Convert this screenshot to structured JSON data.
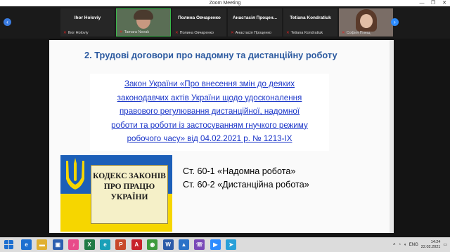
{
  "window": {
    "title": "Zoom Meeting",
    "controls": [
      "—",
      "❐",
      "✕"
    ]
  },
  "gallery": {
    "participants": [
      {
        "name": "Ihor Holoviy",
        "label": "Ihor Holoviy",
        "video": false
      },
      {
        "name": "",
        "label": "Tamara Novak",
        "video": true
      },
      {
        "name": "Полина Овчаренко",
        "label": "Полина Овчаренко",
        "video": false
      },
      {
        "name": "Анастасія Процен...",
        "label": "Анастасія Проценко",
        "video": false
      },
      {
        "name": "Tetiana Kondratiuk",
        "label": "Tetiana Kondratiuk",
        "video": false
      },
      {
        "name": "",
        "label": "София Плещ",
        "video": true
      }
    ]
  },
  "slide": {
    "heading": "2. Трудові договори про надомну та дистанційну роботу",
    "law_lines": [
      "Закон України «Про внесення змін до деяких",
      "законодавчих актів України щодо удосконалення",
      "правового регулювання дистанційної, надомної",
      "роботи та роботи із застосуванням гнучкого режиму",
      "робочого часу» від 04.02.2021 р. № 1213-IX"
    ],
    "code_title_lines": [
      "КОДЕКС ЗАКОНІВ",
      "ПРО ПРАЦЮ",
      "УКРАЇНИ"
    ],
    "articles": [
      "Ст. 60-1 «Надомна робота»",
      "Ст. 60-2 «Дистанційна робота»"
    ]
  },
  "taskbar": {
    "apps": [
      {
        "icon": "edge-legacy-icon",
        "glyph": "e",
        "color": "#1e6fd0"
      },
      {
        "icon": "file-explorer-icon",
        "glyph": "▬",
        "color": "#e0b030"
      },
      {
        "icon": "store-icon",
        "glyph": "▣",
        "color": "#2d5fb0"
      },
      {
        "icon": "itunes-icon",
        "glyph": "♪",
        "color": "#e84a8a"
      },
      {
        "icon": "excel-icon",
        "glyph": "X",
        "color": "#1f7a44"
      },
      {
        "icon": "edge-icon",
        "glyph": "e",
        "color": "#1aa0b8"
      },
      {
        "icon": "powerpoint-icon",
        "glyph": "P",
        "color": "#c8482a"
      },
      {
        "icon": "acrobat-icon",
        "glyph": "A",
        "color": "#c8202a"
      },
      {
        "icon": "chrome-icon",
        "glyph": "◉",
        "color": "#3c9a3c"
      },
      {
        "icon": "word-icon",
        "glyph": "W",
        "color": "#2a5aa8"
      },
      {
        "icon": "photos-icon",
        "glyph": "▲",
        "color": "#2a72c8"
      },
      {
        "icon": "viber-icon",
        "glyph": "☏",
        "color": "#7a4ab8"
      },
      {
        "icon": "zoom-icon",
        "glyph": "▶",
        "color": "#2d8cff"
      },
      {
        "icon": "telegram-icon",
        "glyph": "➤",
        "color": "#2aa0d8"
      }
    ],
    "language": "ENG",
    "time": "14:24",
    "date": "22.02.2021"
  },
  "colors": {
    "heading": "#2c5aa0",
    "law_text": "#1a35c8",
    "flag_blue": "#1c5fb8",
    "flag_yellow": "#f6d600"
  }
}
